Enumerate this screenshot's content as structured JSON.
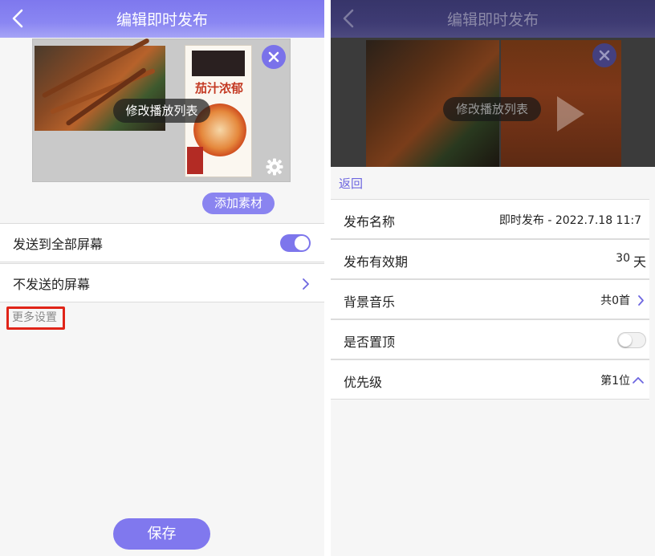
{
  "left": {
    "title": "编辑即时发布",
    "preview": {
      "edit_playlist_label": "修改播放列表",
      "poster_text": "茄汁浓郁"
    },
    "add_material_label": "添加素材",
    "settings": [
      {
        "label": "发送到全部屏幕",
        "toggle": true
      },
      {
        "label": "不发送的屏幕"
      }
    ],
    "more_settings_label": "更多设置",
    "save_label": "保存"
  },
  "right": {
    "title": "编辑即时发布",
    "edit_playlist_label": "修改播放列表",
    "return_label": "返回",
    "rows": [
      {
        "label": "发布名称",
        "value": "即时发布 - 2022.7.18 11:7"
      },
      {
        "label": "发布有效期",
        "value": "30",
        "unit": "天"
      },
      {
        "label": "背景音乐",
        "value": "共0首"
      },
      {
        "label": "是否置顶",
        "toggle": false
      },
      {
        "label": "优先级",
        "value": "第1位"
      }
    ]
  },
  "colors": {
    "accent": "#7d76ec",
    "highlight_box": "#e02418"
  },
  "icons": [
    "back-arrow-icon",
    "close-icon",
    "gear-icon",
    "chevron-right-icon",
    "chevron-up-icon",
    "play-icon"
  ]
}
